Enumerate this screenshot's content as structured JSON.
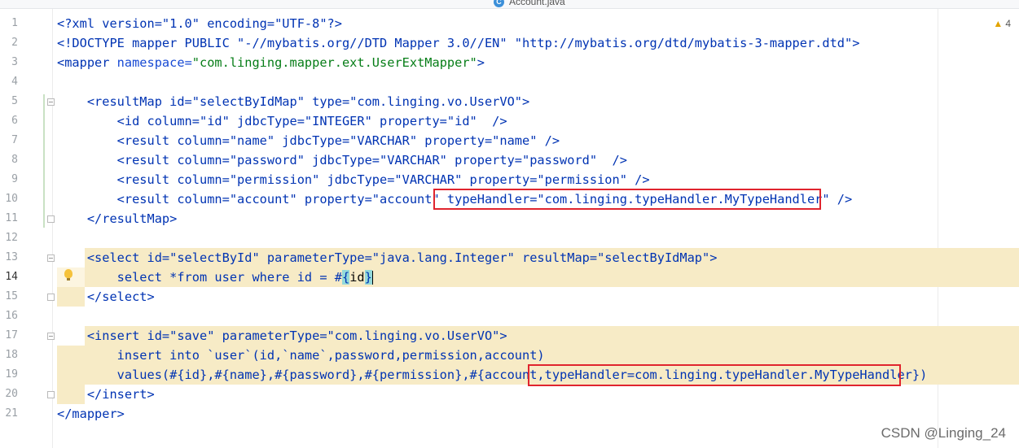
{
  "tab": {
    "title": "Account.java",
    "icon": "C"
  },
  "inspection": {
    "warnings": "4"
  },
  "watermark": "CSDN @Linging_24",
  "line_numbers": [
    "1",
    "2",
    "3",
    "4",
    "5",
    "6",
    "7",
    "8",
    "9",
    "10",
    "11",
    "12",
    "13",
    "14",
    "15",
    "16",
    "17",
    "18",
    "19",
    "20",
    "21"
  ],
  "code": {
    "l1": "<?xml version=\"1.0\" encoding=\"UTF-8\"?>",
    "l2": "<!DOCTYPE mapper PUBLIC \"-//mybatis.org//DTD Mapper 3.0//EN\" \"http://mybatis.org/dtd/mybatis-3-mapper.dtd\">",
    "l3_tag": "<mapper",
    "l3_attr": " namespace=",
    "l3_val": "\"com.linging.mapper.ext.UserExtMapper\"",
    "l3_end": ">",
    "l5": "    <resultMap id=\"selectByIdMap\" type=\"com.linging.vo.UserVO\">",
    "l6": "        <id column=\"id\" jdbcType=\"INTEGER\" property=\"id\"  />",
    "l7": "        <result column=\"name\" jdbcType=\"VARCHAR\" property=\"name\" />",
    "l8": "        <result column=\"password\" jdbcType=\"VARCHAR\" property=\"password\"  />",
    "l9": "        <result column=\"permission\" jdbcType=\"VARCHAR\" property=\"permission\" />",
    "l10": "        <result column=\"account\" property=\"account\" typeHandler=\"com.linging.typeHandler.MyTypeHandler\" />",
    "l11": "    </resultMap>",
    "l13": "    <select id=\"selectById\" parameterType=\"java.lang.Integer\" resultMap=\"selectByIdMap\">",
    "l14_pre": "        select *from user where id = #",
    "l14_brace": "{",
    "l14_id": "id",
    "l14_close": "}",
    "l15": "    </select>",
    "l17": "    <insert id=\"save\" parameterType=\"com.linging.vo.UserVO\">",
    "l18": "        insert into `user`(id,`name`,password,permission,account)",
    "l19": "        values(#{id},#{name},#{password},#{permission},#{account,typeHandler=com.linging.typeHandler.MyTypeHandler})",
    "l20": "    </insert>",
    "l21": "</mapper>"
  }
}
